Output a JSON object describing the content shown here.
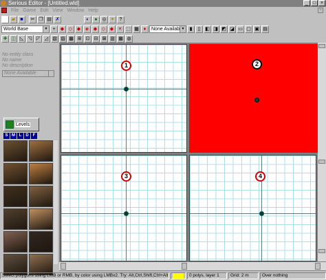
{
  "window": {
    "title": "Serious Editor - [Untitled.wld]",
    "buttons": [
      "_",
      "□",
      "×"
    ]
  },
  "menu": {
    "items": [
      "File",
      "Game",
      "Edit",
      "View",
      "Window",
      "Help"
    ]
  },
  "toolbar": {
    "world_combo": "World Base",
    "none_combo": "None Available"
  },
  "properties": {
    "lines": [
      "No entity class",
      "No name",
      "No description"
    ],
    "combo": "None Available"
  },
  "browser": {
    "folder_label": "Levels",
    "tabs": [
      "S",
      "M",
      "L",
      "D",
      "F"
    ],
    "thumb_colors": [
      "#6a5030",
      "#a07040",
      "#705030",
      "#c08040",
      "#403020",
      "#806040",
      "#504030",
      "#c09060",
      "#806050",
      "#302820",
      "#605040",
      "#907050"
    ]
  },
  "viewports": [
    {
      "number": "1",
      "highlight": false
    },
    {
      "number": "2",
      "highlight": true
    },
    {
      "number": "3",
      "highlight": false
    },
    {
      "number": "4",
      "highlight": false
    }
  ],
  "status": {
    "hint": "Select polygons using LMB or RMB, by color using LMBx2. Try: Alt,Ctrl,Shift,Ctrl+Alt",
    "polys": "0 polys, layer 1",
    "grid": "Grid: 2 m",
    "over": "Over nothing"
  },
  "colors": {
    "selected_viewport": "#ff0000",
    "grid_line": "#aeddea",
    "status_color": "#ffff00"
  }
}
